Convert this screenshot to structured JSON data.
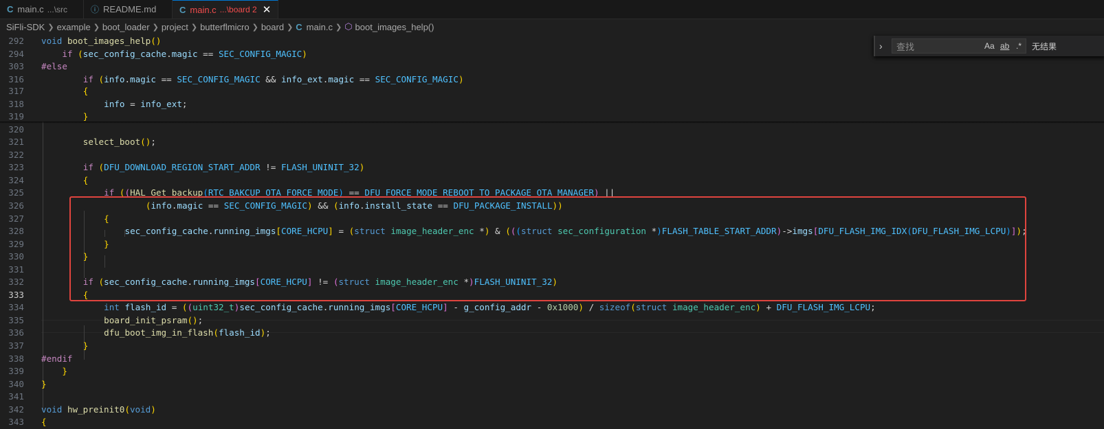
{
  "tabs": [
    {
      "name": "main.c",
      "desc": "...\\src"
    },
    {
      "name": "README.md",
      "desc": ""
    },
    {
      "name": "main.c",
      "desc": "...\\board 2"
    }
  ],
  "breadcrumb": {
    "items": [
      "SiFli-SDK",
      "example",
      "boot_loader",
      "project",
      "butterflmicro",
      "board"
    ],
    "file": "main.c",
    "symbol": "boot_images_help()"
  },
  "find": {
    "placeholder": "查找",
    "match_case": "Aa",
    "whole_word": "ab",
    "regex": ".*",
    "result": "无结果"
  },
  "sticky_lines": [
    {
      "num": "292",
      "text": "void boot_images_help()"
    },
    {
      "num": "294",
      "text": "    if (sec_config_cache.magic == SEC_CONFIG_MAGIC)"
    },
    {
      "num": "303",
      "text": "#else"
    },
    {
      "num": "316",
      "text": "        if (info.magic == SEC_CONFIG_MAGIC && info_ext.magic == SEC_CONFIG_MAGIC)"
    }
  ],
  "lines": [
    {
      "num": "317",
      "text": "        {"
    },
    {
      "num": "318",
      "text": "            info = info_ext;"
    },
    {
      "num": "319",
      "text": "        }"
    },
    {
      "num": "320",
      "text": ""
    },
    {
      "num": "321",
      "text": "        select_boot();"
    },
    {
      "num": "322",
      "text": ""
    },
    {
      "num": "323",
      "text": "        if (DFU_DOWNLOAD_REGION_START_ADDR != FLASH_UNINIT_32)"
    },
    {
      "num": "324",
      "text": "        {"
    },
    {
      "num": "325",
      "text": "            if ((HAL_Get_backup(RTC_BAKCUP_OTA_FORCE_MODE) == DFU_FORCE_MODE_REBOOT_TO_PACKAGE_OTA_MANAGER) ||"
    },
    {
      "num": "326",
      "text": "                    (info.magic == SEC_CONFIG_MAGIC) && (info.install_state == DFU_PACKAGE_INSTALL))"
    },
    {
      "num": "327",
      "text": "            {"
    },
    {
      "num": "328",
      "text": "                sec_config_cache.running_imgs[CORE_HCPU] = (struct image_header_enc *) & (((struct sec_configuration *)FLASH_TABLE_START_ADDR)->imgs[DFU_FLASH_IMG_IDX(DFU_FLASH_IMG_LCPU)]);"
    },
    {
      "num": "329",
      "text": "            }"
    },
    {
      "num": "330",
      "text": "        }"
    },
    {
      "num": "331",
      "text": ""
    },
    {
      "num": "332",
      "text": "        if (sec_config_cache.running_imgs[CORE_HCPU] != (struct image_header_enc *)FLASH_UNINIT_32)"
    },
    {
      "num": "333",
      "text": "        {"
    },
    {
      "num": "334",
      "text": "            int flash_id = ((uint32_t)sec_config_cache.running_imgs[CORE_HCPU] - g_config_addr - 0x1000) / sizeof(struct image_header_enc) + DFU_FLASH_IMG_LCPU;"
    },
    {
      "num": "335",
      "text": "            board_init_psram();"
    },
    {
      "num": "336",
      "text": "            dfu_boot_img_in_flash(flash_id);"
    },
    {
      "num": "337",
      "text": "        }"
    },
    {
      "num": "338",
      "text": "#endif"
    },
    {
      "num": "339",
      "text": "    }"
    },
    {
      "num": "340",
      "text": "}"
    },
    {
      "num": "341",
      "text": ""
    },
    {
      "num": "342",
      "text": "void hw_preinit0(void)"
    },
    {
      "num": "343",
      "text": "{"
    }
  ],
  "current_line": "333",
  "colors": {
    "highlight_box": "#e0443e",
    "active_tab": "#f14c4c"
  }
}
